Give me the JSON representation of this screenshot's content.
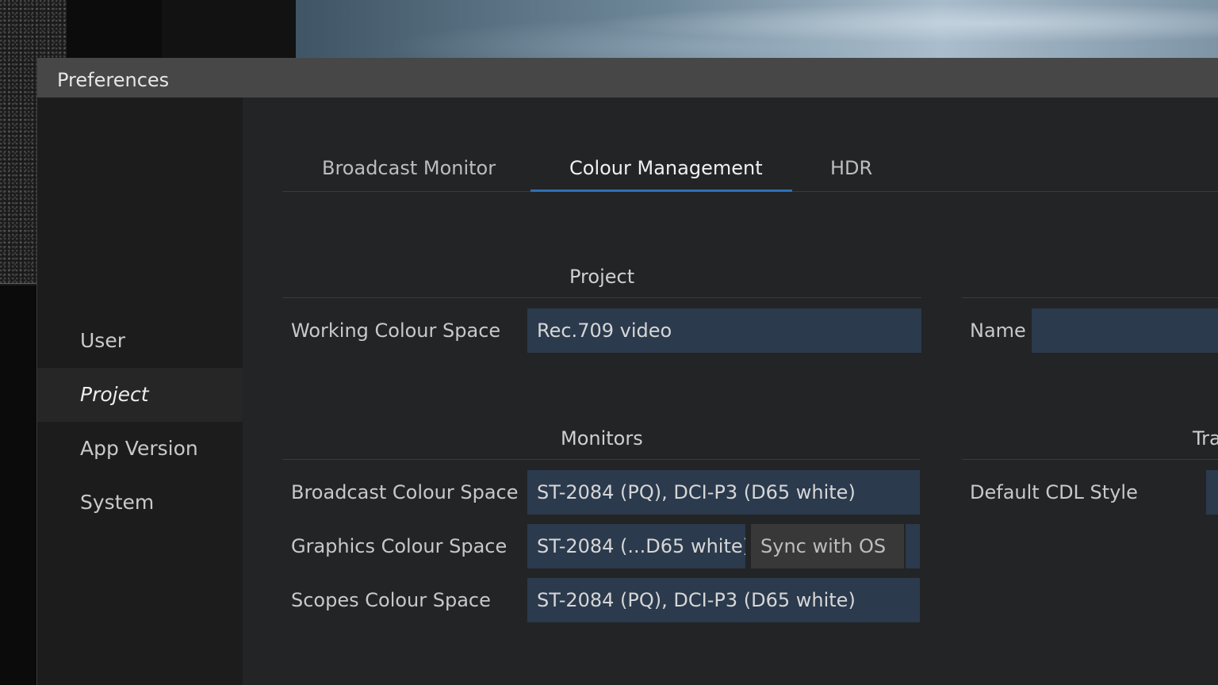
{
  "dialog": {
    "title": "Preferences"
  },
  "sidebar": {
    "items": [
      {
        "label": "User"
      },
      {
        "label": "Project",
        "active": true
      },
      {
        "label": "App Version"
      },
      {
        "label": "System"
      }
    ]
  },
  "tabs": [
    {
      "label": "Broadcast Monitor"
    },
    {
      "label": "Colour Management",
      "active": true
    },
    {
      "label": "HDR"
    }
  ],
  "project_section": {
    "title": "Project",
    "working_colour_space": {
      "label": "Working Colour Space",
      "value": "Rec.709 video"
    }
  },
  "name_section": {
    "name": {
      "label": "Name",
      "value": ""
    }
  },
  "monitors_section": {
    "title": "Monitors",
    "broadcast": {
      "label": "Broadcast Colour Space",
      "value": "ST-2084 (PQ), DCI-P3 (D65 white)"
    },
    "graphics": {
      "label": "Graphics Colour Space",
      "value": "ST-2084 (...D65 white)",
      "sync_label": "Sync with OS"
    },
    "scopes": {
      "label": "Scopes Colour Space",
      "value": "ST-2084 (PQ), DCI-P3 (D65 white)"
    }
  },
  "transforms_section": {
    "title": "Tra",
    "default_cdl_style": {
      "label": "Default CDL Style",
      "value": ""
    }
  },
  "colors": {
    "accent": "#2d6fb8",
    "field_bg": "#2b3a4d",
    "dialog_bg": "#232425",
    "sidebar_bg": "#1c1c1c",
    "titlebar_bg": "#474747"
  }
}
